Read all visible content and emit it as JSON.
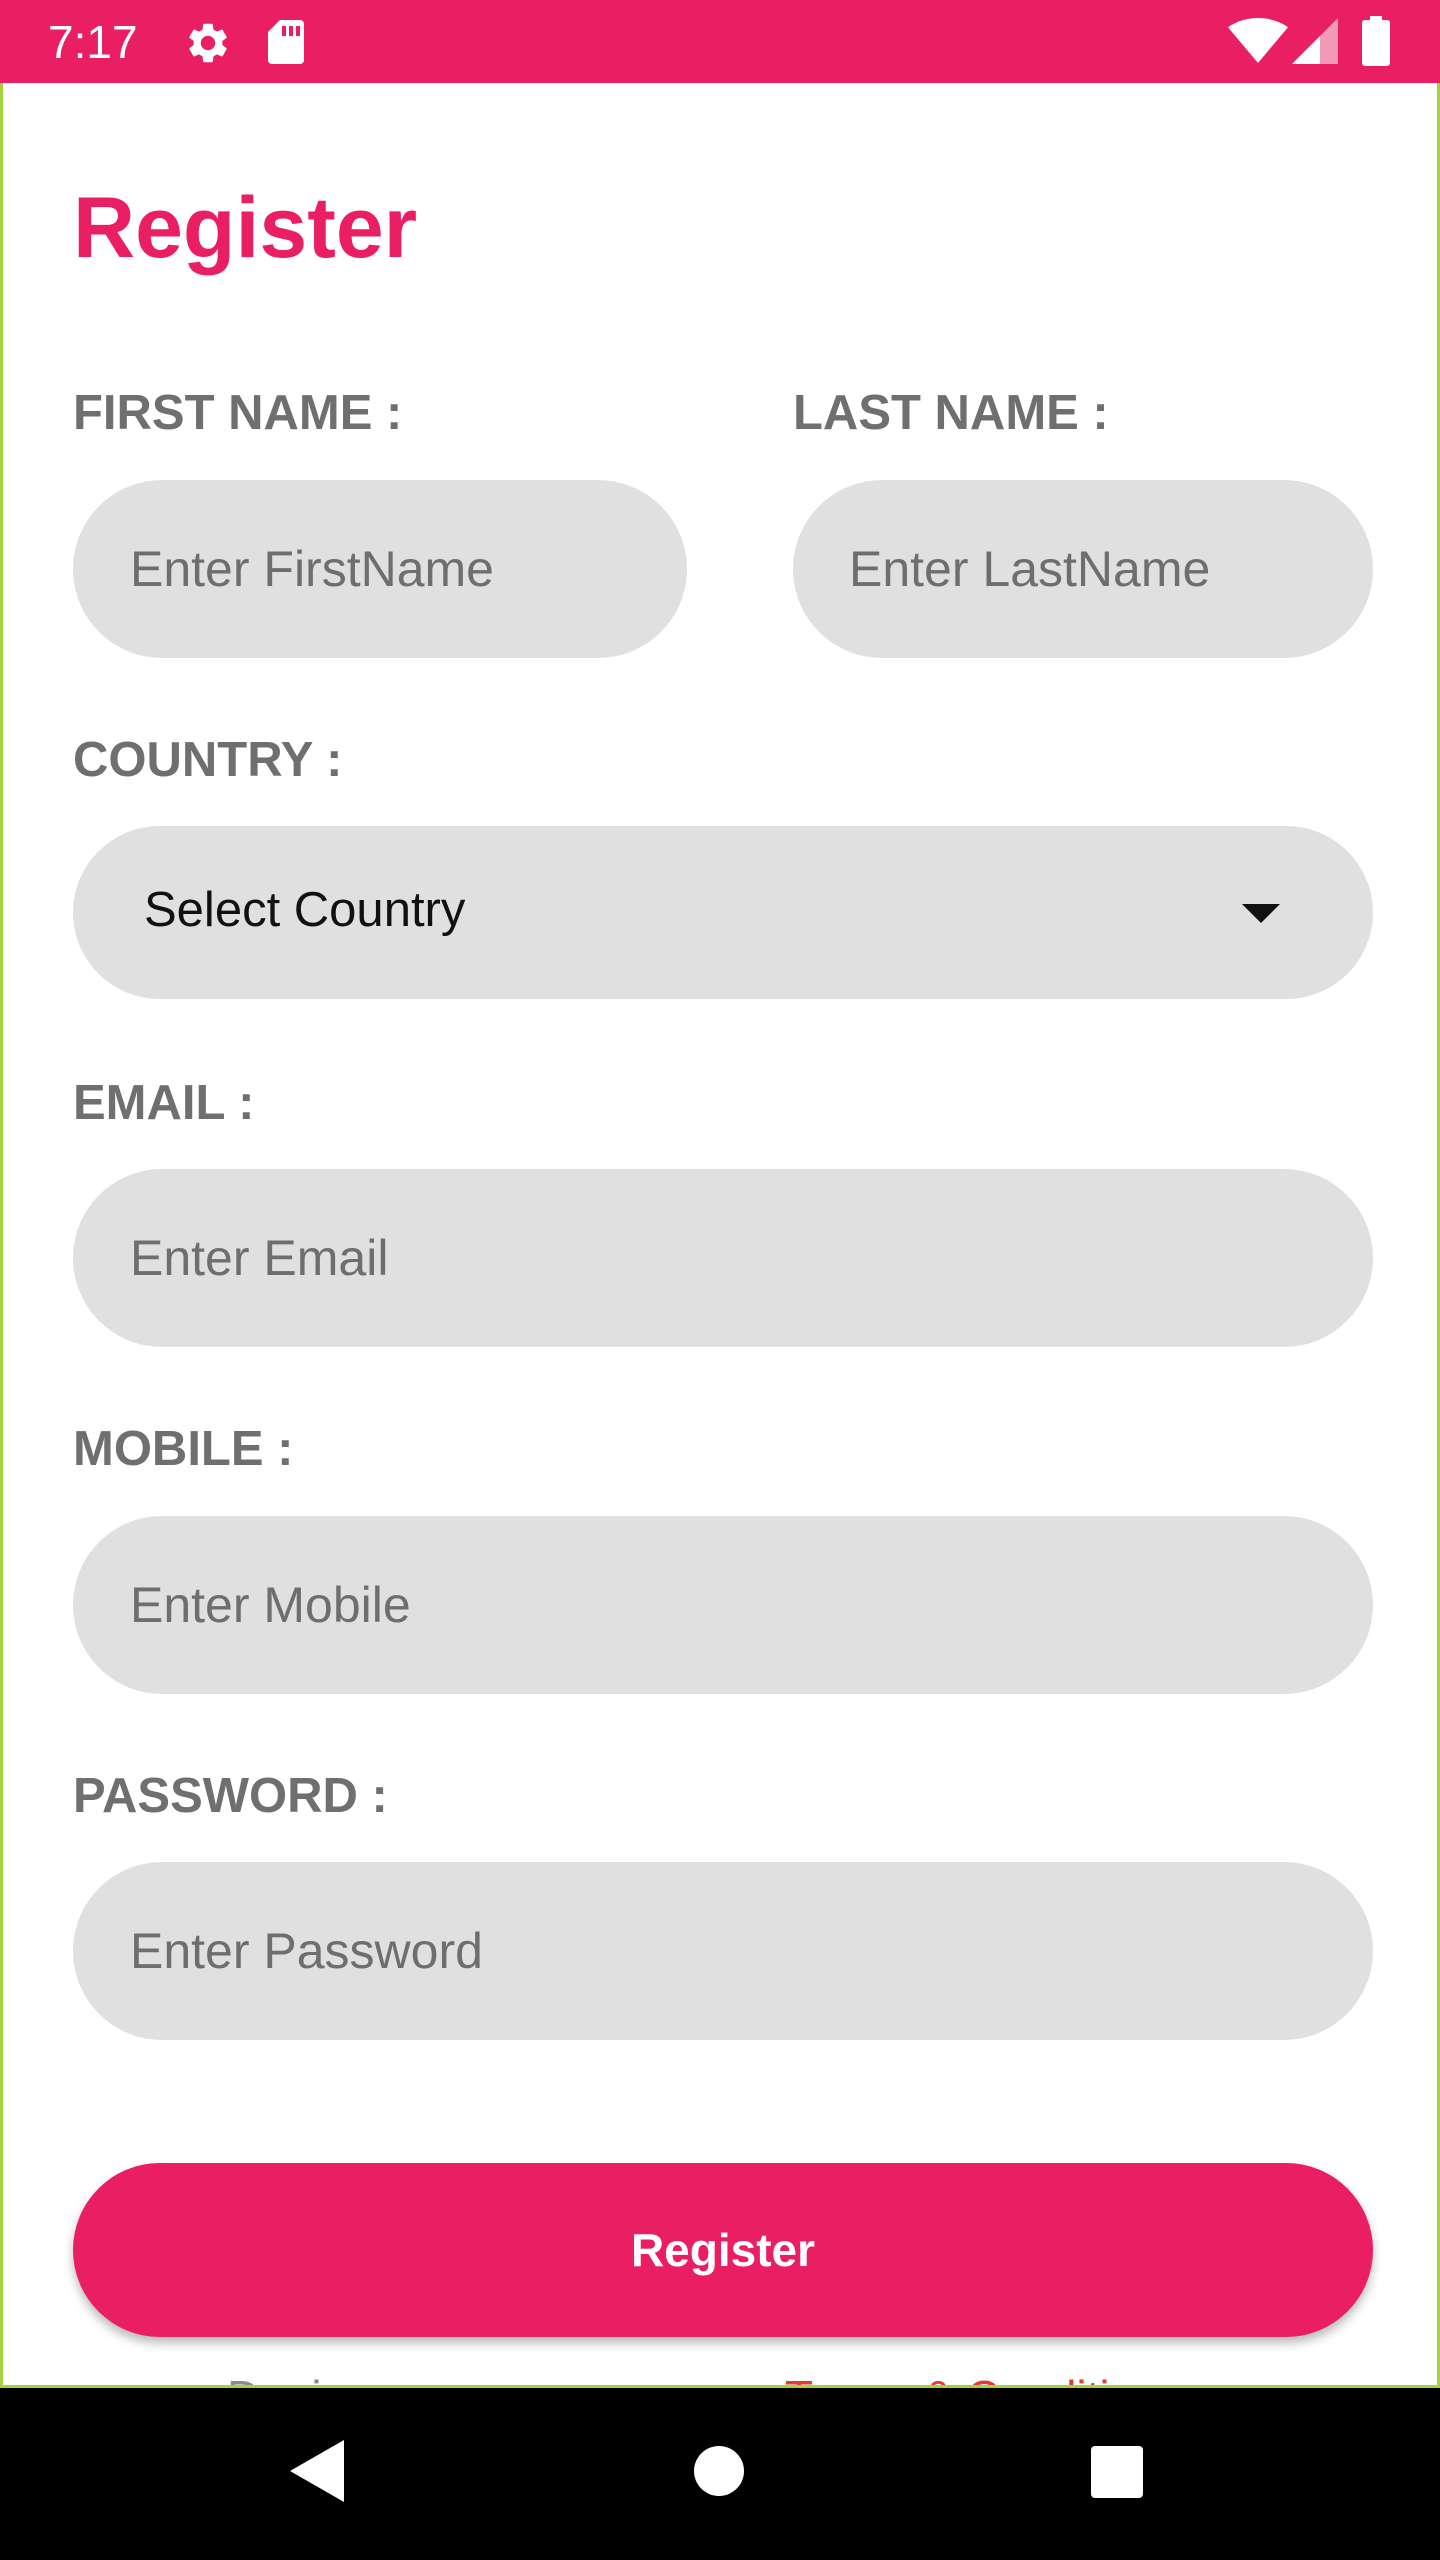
{
  "status_bar": {
    "time": "7:17",
    "icons": [
      "settings-icon",
      "sd-card-icon",
      "wifi-icon",
      "cell-signal-icon",
      "battery-icon"
    ]
  },
  "form": {
    "title": "Register",
    "first_name": {
      "label": "FIRST NAME :",
      "placeholder": "Enter FirstName",
      "value": ""
    },
    "last_name": {
      "label": "LAST NAME :",
      "placeholder": "Enter LastName",
      "value": ""
    },
    "country": {
      "label": "COUNTRY :",
      "selected": "Select Country"
    },
    "email": {
      "label": "EMAIL :",
      "placeholder": "Enter Email",
      "value": ""
    },
    "mobile": {
      "label": "MOBILE :",
      "placeholder": "Enter Mobile",
      "value": ""
    },
    "password": {
      "label": "PASSWORD :",
      "placeholder": "Enter Password",
      "value": ""
    },
    "submit_label": "Register"
  },
  "footer_links": {
    "left_partial": "Dani",
    "right_partial": "Terms & Conditi"
  },
  "nav_bar": {
    "icons": [
      "back-icon",
      "home-icon",
      "recents-icon"
    ]
  },
  "colors": {
    "accent": "#E91E63",
    "input_background": "#E0E0E0",
    "label_text": "#6F6F6F",
    "link_red": "#E53935",
    "link_gray": "#8A8A8A",
    "content_border": "#A4D23C"
  }
}
